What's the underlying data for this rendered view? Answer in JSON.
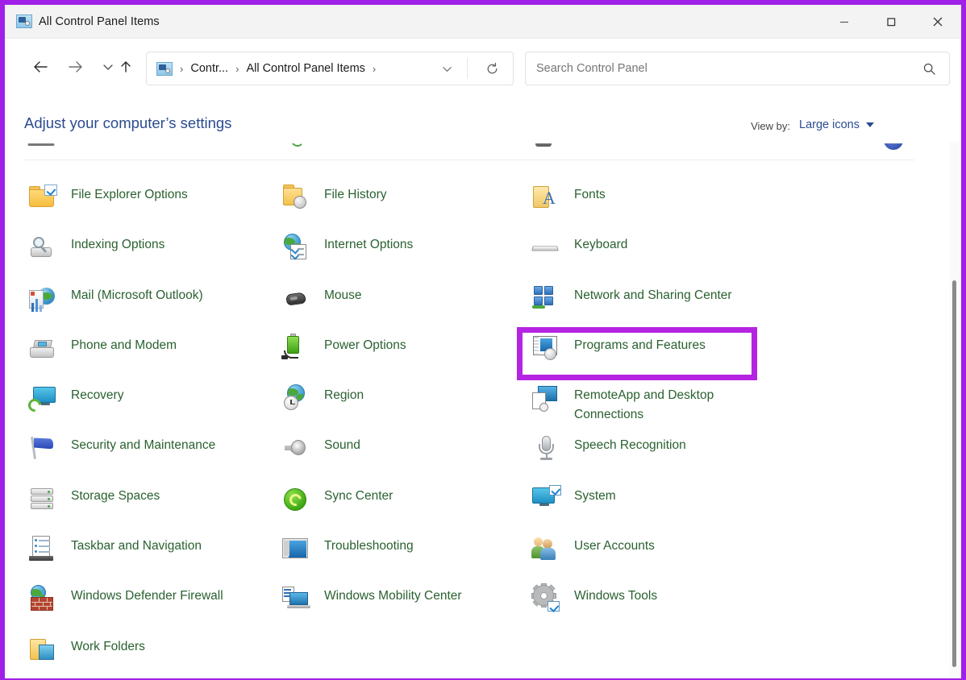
{
  "window": {
    "title": "All Control Panel Items",
    "title_icon": "control-panel-icon",
    "controls": {
      "minimize": "minimize-icon",
      "maximize": "maximize-icon",
      "close": "close-icon"
    }
  },
  "navigation": {
    "back": "back-arrow-icon",
    "forward": "forward-arrow-icon",
    "recent": "chevron-down-icon",
    "up": "up-arrow-icon",
    "refresh": "refresh-icon",
    "breadcrumb_dropdown": "chevron-down-icon",
    "breadcrumbs": [
      {
        "label": "Contr...",
        "separator": "›"
      },
      {
        "label": "All Control Panel Items",
        "separator": "›"
      }
    ]
  },
  "search": {
    "placeholder": "Search Control Panel",
    "icon": "search-icon"
  },
  "header": {
    "heading": "Adjust your computer’s settings",
    "view_by_label": "View by:",
    "view_by_value": "Large icons",
    "view_by_caret": "caret-down-icon"
  },
  "highlight": {
    "target": "Programs and Features",
    "color": "#b424e2"
  },
  "scrollbar": {
    "orientation": "vertical",
    "thumb_position": "middle"
  },
  "columns": [
    {
      "name": "column-1",
      "items": [
        {
          "label": "File Explorer Options",
          "icon": "file-explorer-options-icon"
        },
        {
          "label": "Indexing Options",
          "icon": "indexing-options-icon"
        },
        {
          "label": "Mail (Microsoft Outlook)",
          "icon": "mail-outlook-icon"
        },
        {
          "label": "Phone and Modem",
          "icon": "phone-and-modem-icon"
        },
        {
          "label": "Recovery",
          "icon": "recovery-icon"
        },
        {
          "label": "Security and Maintenance",
          "icon": "security-and-maintenance-icon"
        },
        {
          "label": "Storage Spaces",
          "icon": "storage-spaces-icon"
        },
        {
          "label": "Taskbar and Navigation",
          "icon": "taskbar-and-navigation-icon"
        },
        {
          "label": "Windows Defender Firewall",
          "icon": "windows-defender-firewall-icon"
        },
        {
          "label": "Work Folders",
          "icon": "work-folders-icon"
        }
      ]
    },
    {
      "name": "column-2",
      "items": [
        {
          "label": "File History",
          "icon": "file-history-icon"
        },
        {
          "label": "Internet Options",
          "icon": "internet-options-icon"
        },
        {
          "label": "Mouse",
          "icon": "mouse-icon"
        },
        {
          "label": "Power Options",
          "icon": "power-options-icon"
        },
        {
          "label": "Region",
          "icon": "region-icon"
        },
        {
          "label": "Sound",
          "icon": "sound-icon"
        },
        {
          "label": "Sync Center",
          "icon": "sync-center-icon"
        },
        {
          "label": "Troubleshooting",
          "icon": "troubleshooting-icon"
        },
        {
          "label": "Windows Mobility Center",
          "icon": "windows-mobility-center-icon"
        }
      ]
    },
    {
      "name": "column-3",
      "items": [
        {
          "label": "Fonts",
          "icon": "fonts-icon"
        },
        {
          "label": "Keyboard",
          "icon": "keyboard-icon"
        },
        {
          "label": "Network and Sharing Center",
          "icon": "network-and-sharing-center-icon"
        },
        {
          "label": "Programs and Features",
          "icon": "programs-and-features-icon"
        },
        {
          "label": "RemoteApp and Desktop Connections",
          "icon": "remoteapp-and-desktop-connections-icon"
        },
        {
          "label": "Speech Recognition",
          "icon": "speech-recognition-icon"
        },
        {
          "label": "System",
          "icon": "system-icon"
        },
        {
          "label": "User Accounts",
          "icon": "user-accounts-icon"
        },
        {
          "label": "Windows Tools",
          "icon": "windows-tools-icon"
        }
      ]
    }
  ]
}
